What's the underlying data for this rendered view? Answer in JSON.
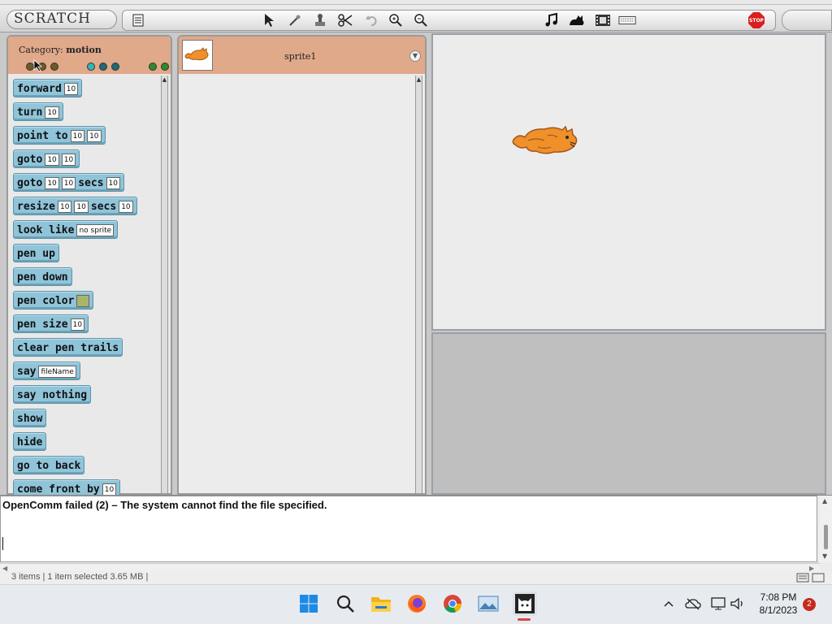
{
  "app": {
    "logo_text": "SCRATCH"
  },
  "toolbar": {
    "tools": [
      "menu-icon",
      "arrow-cursor-icon",
      "magic-wand-icon",
      "stamp-icon",
      "scissors-icon",
      "undo-icon",
      "zoom-in-icon",
      "zoom-out-icon"
    ],
    "media_tools": [
      "music-note-icon",
      "cat-icon",
      "film-icon",
      "keyboard-icon"
    ],
    "stop_label": "STOP"
  },
  "palette": {
    "category_label": "Category:",
    "category_value": "motion",
    "category_dot_colors": [
      "#6b5a2a",
      "#6b5a2a",
      "#6b5a2a",
      "#2fb7b9",
      "#1d6a78",
      "#1d6a78",
      "#2f8a2f",
      "#2f8a2f"
    ],
    "blocks": [
      {
        "parts": [
          {
            "t": "text",
            "v": "forward"
          },
          {
            "t": "slot",
            "v": "10"
          }
        ]
      },
      {
        "parts": [
          {
            "t": "text",
            "v": "turn"
          },
          {
            "t": "slot",
            "v": "10"
          }
        ]
      },
      {
        "parts": [
          {
            "t": "text",
            "v": "point to"
          },
          {
            "t": "slot",
            "v": "10"
          },
          {
            "t": "slot",
            "v": "10"
          }
        ]
      },
      {
        "parts": [
          {
            "t": "text",
            "v": "goto"
          },
          {
            "t": "slot",
            "v": "10"
          },
          {
            "t": "slot",
            "v": "10"
          }
        ]
      },
      {
        "parts": [
          {
            "t": "text",
            "v": "goto"
          },
          {
            "t": "slot",
            "v": "10"
          },
          {
            "t": "slot",
            "v": "10"
          },
          {
            "t": "text",
            "v": "secs"
          },
          {
            "t": "slot",
            "v": "10"
          }
        ]
      },
      {
        "parts": [
          {
            "t": "text",
            "v": "resize"
          },
          {
            "t": "slot",
            "v": "10"
          },
          {
            "t": "slot",
            "v": "10"
          },
          {
            "t": "text",
            "v": "secs"
          },
          {
            "t": "slot",
            "v": "10"
          }
        ]
      },
      {
        "parts": [
          {
            "t": "text",
            "v": "look like"
          },
          {
            "t": "slot",
            "v": "no sprite"
          }
        ]
      },
      {
        "parts": [
          {
            "t": "text",
            "v": "pen up"
          }
        ]
      },
      {
        "parts": [
          {
            "t": "text",
            "v": "pen down"
          }
        ]
      },
      {
        "parts": [
          {
            "t": "text",
            "v": "pen color"
          },
          {
            "t": "color",
            "v": "#a9b66a"
          }
        ]
      },
      {
        "parts": [
          {
            "t": "text",
            "v": "pen size"
          },
          {
            "t": "slot",
            "v": "10"
          }
        ]
      },
      {
        "parts": [
          {
            "t": "text",
            "v": "clear pen trails"
          }
        ]
      },
      {
        "parts": [
          {
            "t": "text",
            "v": "say"
          },
          {
            "t": "slot",
            "v": "fileName"
          }
        ]
      },
      {
        "parts": [
          {
            "t": "text",
            "v": "say nothing"
          }
        ]
      },
      {
        "parts": [
          {
            "t": "text",
            "v": "show"
          }
        ]
      },
      {
        "parts": [
          {
            "t": "text",
            "v": "hide"
          }
        ]
      },
      {
        "parts": [
          {
            "t": "text",
            "v": "go to back"
          }
        ]
      },
      {
        "parts": [
          {
            "t": "text",
            "v": "come front by"
          },
          {
            "t": "slot",
            "v": "10"
          }
        ]
      }
    ]
  },
  "sprite_panel": {
    "sprite_name": "sprite1"
  },
  "console": {
    "message": "OpenComm failed (2) – The system cannot find the file specified."
  },
  "status_bar": {
    "left": "3 items  |  1 item selected  3.65 MB  |"
  },
  "taskbar": {
    "apps": [
      "windows-start-icon",
      "search-icon",
      "file-explorer-icon",
      "firefox-icon",
      "chrome-icon",
      "photos-icon",
      "scratch-cat-icon"
    ],
    "time": "7:08 PM",
    "date": "8/1/2023",
    "notification_count": "2"
  }
}
